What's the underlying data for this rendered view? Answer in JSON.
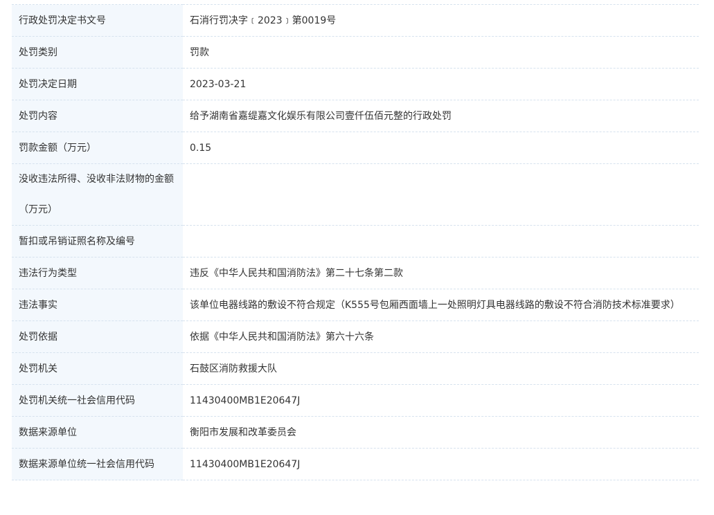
{
  "rows": [
    {
      "label": "行政处罚决定书文号",
      "value": "石消行罚决字﹝2023﹞第0019号"
    },
    {
      "label": "处罚类别",
      "value": "罚款"
    },
    {
      "label": "处罚决定日期",
      "value": "2023-03-21"
    },
    {
      "label": "处罚内容",
      "value": "给予湖南省嘉缇嘉文化娱乐有限公司壹仟伍佰元整的行政处罚"
    },
    {
      "label": "罚款金额（万元）",
      "value": "0.15"
    },
    {
      "label": "没收违法所得、没收非法财物的金额（万元）",
      "value": ""
    },
    {
      "label": "暂扣或吊销证照名称及编号",
      "value": ""
    },
    {
      "label": "违法行为类型",
      "value": "违反《中华人民共和国消防法》第二十七条第二款"
    },
    {
      "label": "违法事实",
      "value": "该单位电器线路的敷设不符合规定（K555号包厢西面墙上一处照明灯具电器线路的敷设不符合消防技术标准要求）"
    },
    {
      "label": "处罚依据",
      "value": "依据《中华人民共和国消防法》第六十六条"
    },
    {
      "label": "处罚机关",
      "value": "石鼓区消防救援大队"
    },
    {
      "label": "处罚机关统一社会信用代码",
      "value": "11430400MB1E20647J"
    },
    {
      "label": "数据来源单位",
      "value": "衡阳市发展和改革委员会"
    },
    {
      "label": "数据来源单位统一社会信用代码",
      "value": "11430400MB1E20647J"
    }
  ]
}
